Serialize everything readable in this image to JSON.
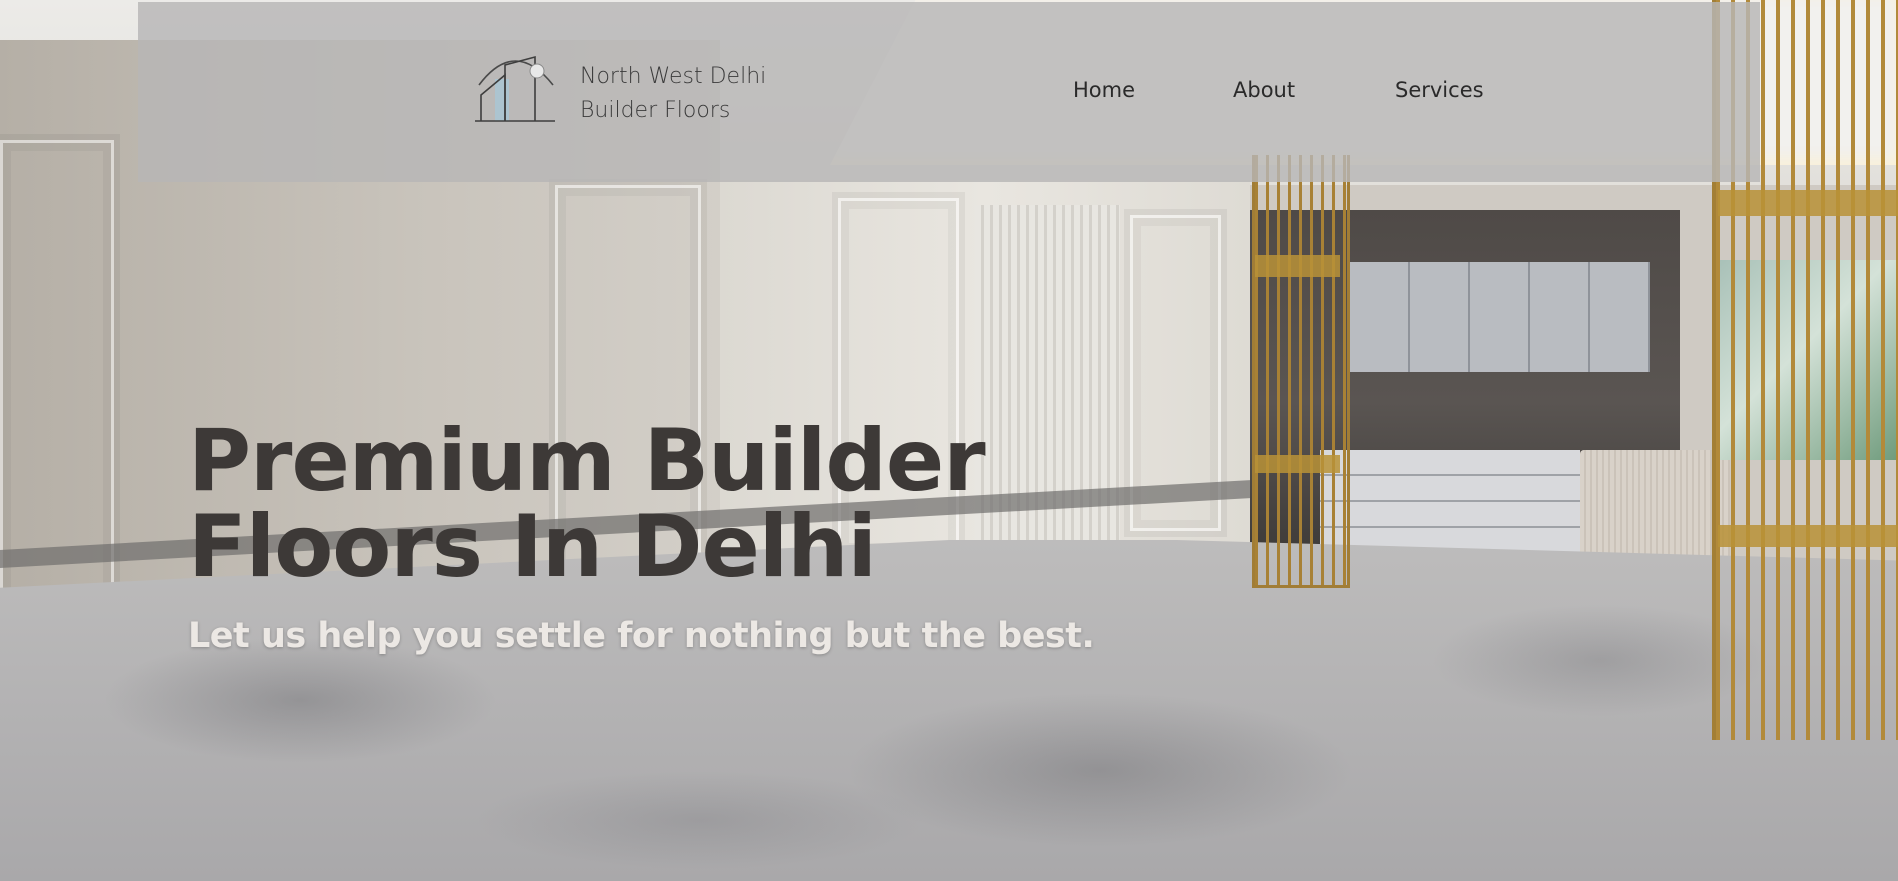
{
  "header": {
    "brand_line1": "North West Delhi",
    "brand_line2": "Builder Floors",
    "logo_icon": "house-outline-icon",
    "nav": [
      {
        "label": "Home"
      },
      {
        "label": "About"
      },
      {
        "label": "Services"
      }
    ]
  },
  "hero": {
    "headline_line1": "Premium Builder",
    "headline_line2": "Floors In Delhi",
    "tagline": "Let us help you settle for nothing but the best."
  },
  "colors": {
    "header_bg": "#b7b6b6",
    "headline": "#3d3937",
    "tagline": "#ece8e4",
    "nav_text": "#2a2a2a"
  }
}
